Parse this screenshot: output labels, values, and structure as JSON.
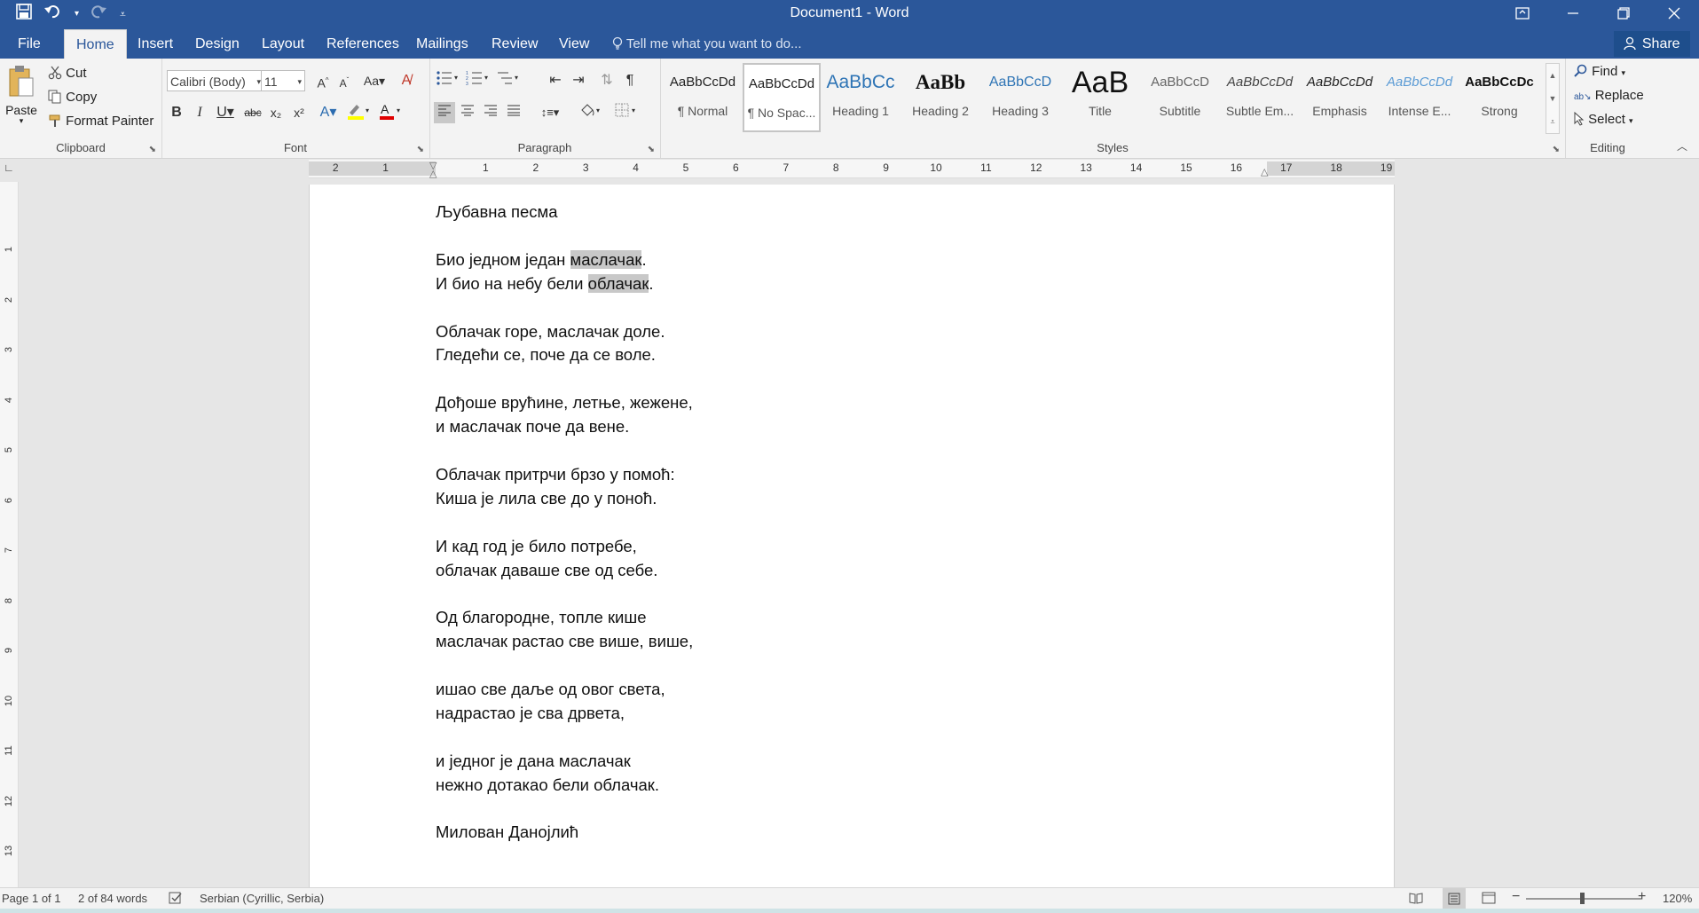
{
  "app": {
    "window_title": "Document1 - Word"
  },
  "qat": {
    "save_icon": "save-icon",
    "undo_icon": "undo-icon",
    "redo_icon": "redo-icon"
  },
  "tabs": {
    "file": "File",
    "home": "Home",
    "insert": "Insert",
    "design": "Design",
    "layout": "Layout",
    "references": "References",
    "mailings": "Mailings",
    "review": "Review",
    "view": "View",
    "tell_me": "Tell me what you want to do...",
    "share": "Share"
  },
  "clipboard": {
    "paste": "Paste",
    "cut": "Cut",
    "copy": "Copy",
    "format_painter": "Format Painter",
    "label": "Clipboard"
  },
  "font": {
    "family": "Calibri (Body)",
    "size": "11",
    "label": "Font"
  },
  "paragraph": {
    "label": "Paragraph"
  },
  "styles": {
    "label": "Styles",
    "items": [
      {
        "preview": "AaBbCcDd",
        "name": "¶ Normal"
      },
      {
        "preview": "AaBbCcDd",
        "name": "¶ No Spac..."
      },
      {
        "preview": "AaBbCc",
        "name": "Heading 1"
      },
      {
        "preview": "AaBb",
        "name": "Heading 2"
      },
      {
        "preview": "AaBbCcD",
        "name": "Heading 3"
      },
      {
        "preview": "AaB",
        "name": "Title"
      },
      {
        "preview": "AaBbCcD",
        "name": "Subtitle"
      },
      {
        "preview": "AaBbCcDd",
        "name": "Subtle Em..."
      },
      {
        "preview": "AaBbCcDd",
        "name": "Emphasis"
      },
      {
        "preview": "AaBbCcDd",
        "name": "Intense E..."
      },
      {
        "preview": "AaBbCcDc",
        "name": "Strong"
      }
    ]
  },
  "editing": {
    "find": "Find",
    "replace": "Replace",
    "select": "Select",
    "label": "Editing"
  },
  "ruler": {
    "h_labels": [
      "2",
      "1",
      "1",
      "2",
      "3",
      "4",
      "5",
      "6",
      "7",
      "8",
      "9",
      "10",
      "11",
      "12",
      "13",
      "14",
      "15",
      "16",
      "17",
      "18",
      "19"
    ],
    "v_labels": [
      "1",
      "2",
      "3",
      "4",
      "5",
      "6",
      "7",
      "8",
      "9",
      "10",
      "11",
      "12",
      "13"
    ]
  },
  "document": {
    "lines": [
      "Љубавна песма",
      "",
      "Био једном један маслачак.",
      "И био на небу бели облачак.",
      "",
      "Облачак горе, маслачак доле.",
      "Гледећи се, поче да се воле.",
      "",
      "Дођоше врућине, летње, жежене,",
      "и маслачак поче да вене.",
      "",
      "Облачак притрчи брзо у помоћ:",
      "Киша је лила све до у поноћ.",
      "",
      "И кад год је било потребе,",
      "облачак даваше све од себе.",
      "",
      "Од благородне, топле кише",
      "маслачак растао све више, више,",
      "",
      "ишао све даље од овог света,",
      "надрастао је сва дрвета,",
      "",
      "и једног је дана маслачак",
      "нежно дотакао бели облачак.",
      "",
      "Милован Данојлић"
    ],
    "line2_pre": "Био једном један ",
    "line2_hl": "маслачак",
    "line2_post": ".",
    "line3_pre": "И био на небу бели ",
    "line3_hl": "облачак",
    "line3_post": "."
  },
  "status": {
    "page": "Page 1 of 1",
    "words": "2 of 84 words",
    "language": "Serbian (Cyrillic, Serbia)",
    "zoom": "120%"
  },
  "colors": {
    "accent": "#2b579a"
  }
}
